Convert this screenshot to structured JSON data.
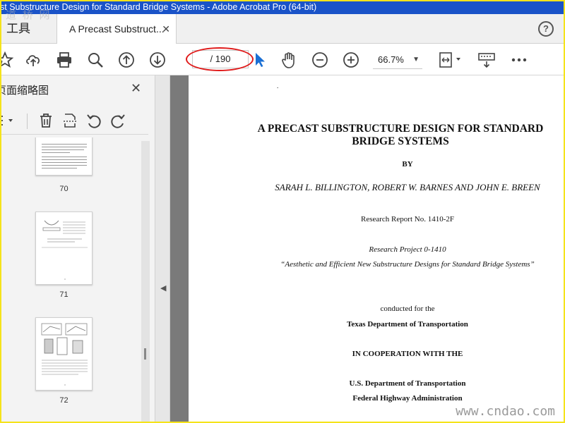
{
  "window": {
    "title": "st Substructure Design for Standard Bridge Systems - Adobe Acrobat Pro (64-bit)",
    "watermark_top": "道 桥 网"
  },
  "tabs": {
    "tools_label": "工具",
    "doc_label": "A Precast Substruct...",
    "close_glyph": "✕",
    "help_glyph": "?"
  },
  "toolbar": {
    "page_indicator": "/ 190",
    "zoom": "66.7%",
    "icons": [
      "bookmark-star-icon",
      "upload-icon",
      "print-icon",
      "search-icon",
      "prev-page-icon",
      "next-page-icon",
      "select-cursor-icon",
      "hand-tool-icon",
      "zoom-out-icon",
      "zoom-in-icon",
      "fit-page-icon",
      "keyboard-icon",
      "more-icon"
    ]
  },
  "panel": {
    "title": "页面缩略图",
    "close_glyph": "✕",
    "thumbnails": [
      {
        "page": "70"
      },
      {
        "page": "71"
      },
      {
        "page": "72"
      }
    ]
  },
  "document": {
    "dot": ".",
    "title_line1": "A PRECAST SUBSTRUCTURE DESIGN FOR STANDARD",
    "title_line2": "BRIDGE SYSTEMS",
    "by": "BY",
    "authors": "SARAH L. BILLINGTON, ROBERT W. BARNES AND JOHN E. BREEN",
    "report": "Research Report No. 1410-2F",
    "project": "Research Project 0-1410",
    "project_title": "“Aesthetic and Efficient New Substructure Designs for Standard Bridge Systems”",
    "conducted": "conducted for the",
    "txdot": "Texas Department of Transportation",
    "cooperation": "IN COOPERATION WITH THE",
    "usdot": "U.S. Department of Transportation",
    "fhwa": "Federal Highway Administration"
  },
  "watermark_bottom": "www.cndao.com",
  "colors": {
    "titlebar": "#1a53c8",
    "highlight_oval": "#e01b1b",
    "frame": "#f5e31a",
    "cursor": "#1a6fd4"
  }
}
